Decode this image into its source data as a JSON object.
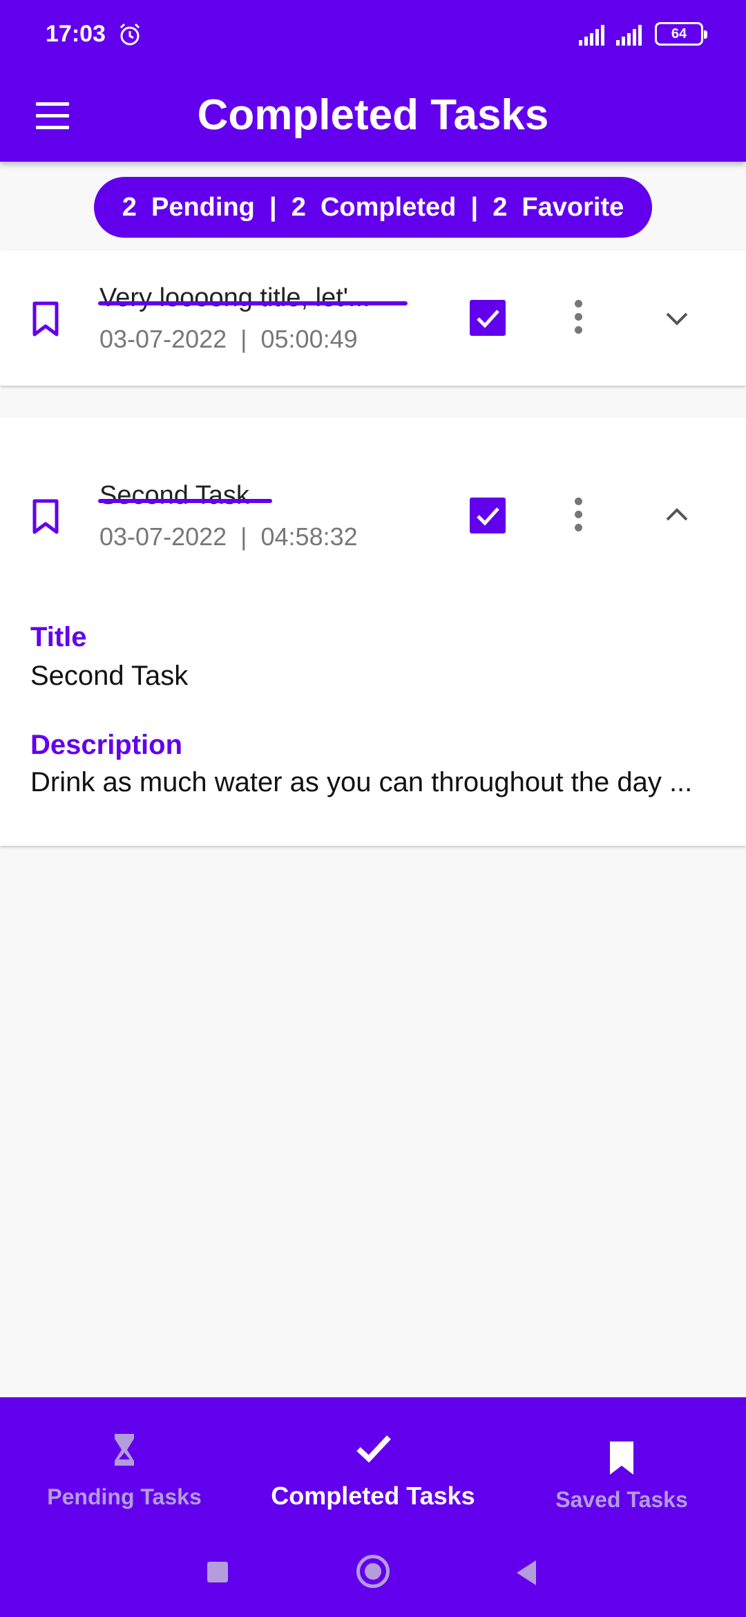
{
  "status_bar": {
    "time": "17:03",
    "battery": "64"
  },
  "toolbar": {
    "title": "Completed Tasks",
    "menu_icon": "hamburger-menu-icon"
  },
  "summary": {
    "pending_count": "2",
    "pending_label": "Pending",
    "completed_count": "2",
    "completed_label": "Completed",
    "favorite_count": "2",
    "favorite_label": "Favorite",
    "text": "2  Pending  |  2  Completed  |  2  Favorite"
  },
  "tasks": [
    {
      "title": "Very loooong title, let'...",
      "date": "03-07-2022  |  05:00:49",
      "completed": true,
      "expanded": false
    },
    {
      "title": "Second Task",
      "date": "03-07-2022  |  04:58:32",
      "completed": true,
      "expanded": true,
      "detail_title_label": "Title",
      "detail_title_value": "Second Task",
      "detail_description_label": "Description",
      "detail_description_value": "Drink as much water as you can throughout the day ..."
    }
  ],
  "bottom_nav": {
    "items": [
      {
        "label": "Pending Tasks",
        "icon": "hourglass-icon",
        "active": false
      },
      {
        "label": "Completed Tasks",
        "icon": "check-icon",
        "active": true
      },
      {
        "label": "Saved Tasks",
        "icon": "bookmark-icon",
        "active": false
      }
    ]
  },
  "colors": {
    "primary": "#6200ee",
    "inactive_nav": "#b39ddb",
    "background": "#f8f8f8"
  }
}
